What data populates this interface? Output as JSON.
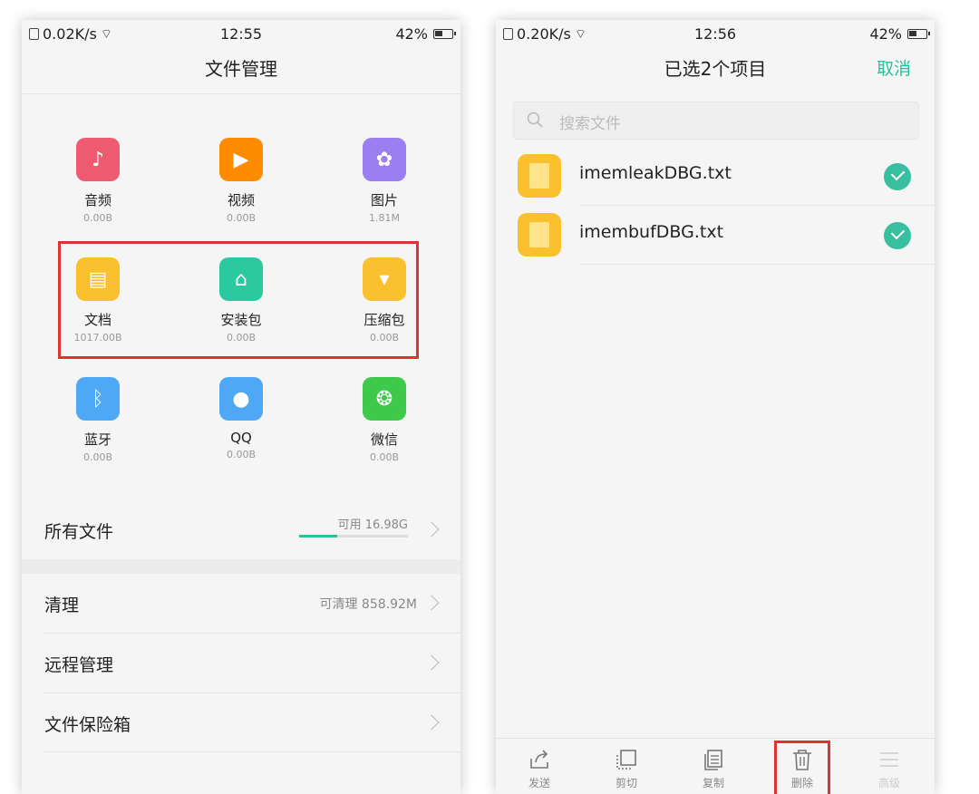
{
  "left": {
    "status": {
      "net": "0.02K/s",
      "time": "12:55",
      "battery": "42%"
    },
    "title": "文件管理",
    "categories": [
      {
        "label": "音频",
        "size": "0.00B",
        "icon": "music-note-icon",
        "color": "#ee5a6f"
      },
      {
        "label": "视频",
        "size": "0.00B",
        "icon": "play-icon",
        "color": "#ff8c00"
      },
      {
        "label": "图片",
        "size": "1.81M",
        "icon": "flower-icon",
        "color": "#9b7ef0"
      },
      {
        "label": "文档",
        "size": "1017.00B",
        "icon": "document-icon",
        "color": "#fbc02d"
      },
      {
        "label": "安装包",
        "size": "0.00B",
        "icon": "android-icon",
        "color": "#2bc9a0"
      },
      {
        "label": "压缩包",
        "size": "0.00B",
        "icon": "archive-icon",
        "color": "#fbc02d"
      },
      {
        "label": "蓝牙",
        "size": "0.00B",
        "icon": "bluetooth-icon",
        "color": "#4fa8f5"
      },
      {
        "label": "QQ",
        "size": "0.00B",
        "icon": "qq-icon",
        "color": "#4fa8f5"
      },
      {
        "label": "微信",
        "size": "0.00B",
        "icon": "wechat-icon",
        "color": "#3fc94a"
      }
    ],
    "all_files": {
      "label": "所有文件",
      "available": "可用 16.98G",
      "used_fraction": 0.35
    },
    "menu": [
      {
        "label": "清理",
        "right": "可清理 858.92M"
      },
      {
        "label": "远程管理",
        "right": ""
      },
      {
        "label": "文件保险箱",
        "right": ""
      }
    ]
  },
  "right": {
    "status": {
      "net": "0.20K/s",
      "time": "12:56",
      "battery": "42%"
    },
    "title": "已选2个项目",
    "cancel": "取消",
    "search_placeholder": "搜索文件",
    "files": [
      {
        "name": "imemleakDBG.txt",
        "selected": true
      },
      {
        "name": "imembufDBG.txt",
        "selected": true
      }
    ],
    "toolbar": [
      {
        "label": "发送",
        "icon": "share-icon",
        "enabled": true
      },
      {
        "label": "剪切",
        "icon": "cut-icon",
        "enabled": true
      },
      {
        "label": "复制",
        "icon": "copy-icon",
        "enabled": true
      },
      {
        "label": "删除",
        "icon": "trash-icon",
        "enabled": true
      },
      {
        "label": "高级",
        "icon": "menu-icon",
        "enabled": false
      }
    ]
  }
}
